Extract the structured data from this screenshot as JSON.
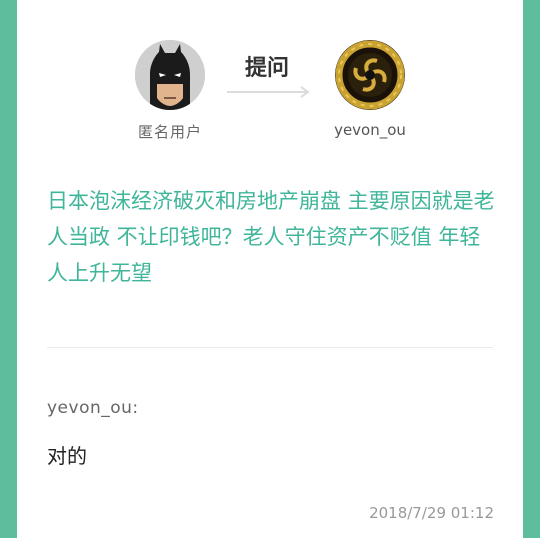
{
  "header": {
    "asker_name": "匿名用户",
    "action_label": "提问",
    "answerer_name": "yevon_ou"
  },
  "question": {
    "text": "日本泡沫经济破灭和房地产崩盘  主要原因就是老人当政  不让印钱吧？老人守住资产不贬值  年轻人上升无望"
  },
  "answer": {
    "author_label": "yevon_ou:",
    "text": "对的",
    "timestamp": "2018/7/29  01:12"
  },
  "colors": {
    "frame": "#5dbd9c",
    "accent_text": "#3fb59a",
    "card": "#ffffff"
  },
  "icons": {
    "asker_avatar": "batman-avatar",
    "answerer_avatar": "dragon-emblem-avatar",
    "arrow": "right-arrow-icon"
  }
}
